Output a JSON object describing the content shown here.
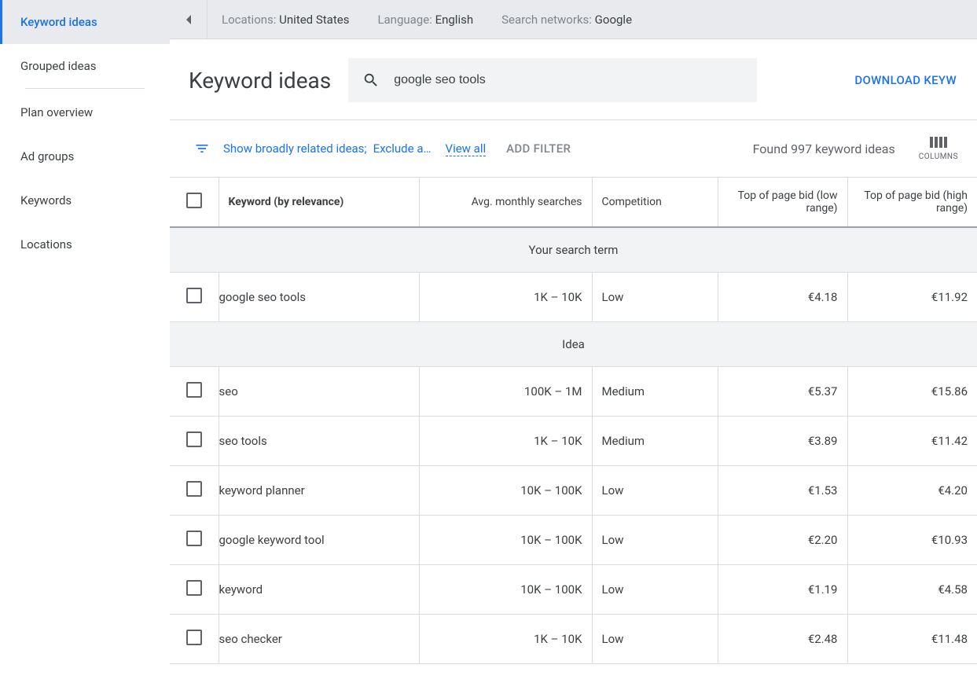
{
  "sidebar": {
    "items": [
      {
        "label": "Keyword ideas",
        "active": true
      },
      {
        "label": "Grouped ideas"
      },
      {
        "label": "Plan overview"
      },
      {
        "label": "Ad groups"
      },
      {
        "label": "Keywords"
      },
      {
        "label": "Locations"
      }
    ]
  },
  "topbar": {
    "locations_label": "Locations:",
    "locations_value": "United States",
    "language_label": "Language:",
    "language_value": "English",
    "networks_label": "Search networks:",
    "networks_value": "Google"
  },
  "header": {
    "title": "Keyword ideas",
    "search_value": "google seo tools",
    "download_label": "DOWNLOAD KEYW"
  },
  "filters": {
    "chip1": "Show broadly related ideas;",
    "chip2": "Exclude a…",
    "view_all": "View all",
    "add_filter": "ADD FILTER",
    "found_text": "Found 997 keyword ideas",
    "columns_label": "COLUMNS"
  },
  "table": {
    "headers": {
      "keyword": "Keyword (by relevance)",
      "searches": "Avg. monthly searches",
      "competition": "Competition",
      "bid_low": "Top of page bid (low range)",
      "bid_high": "Top of page bid (high range)"
    },
    "section1": "Your search term",
    "section2": "Idea",
    "search_term_rows": [
      {
        "keyword": "google seo tools",
        "searches": "1K – 10K",
        "competition": "Low",
        "bid_low": "€4.18",
        "bid_high": "€11.92"
      }
    ],
    "idea_rows": [
      {
        "keyword": "seo",
        "searches": "100K – 1M",
        "competition": "Medium",
        "bid_low": "€5.37",
        "bid_high": "€15.86"
      },
      {
        "keyword": "seo tools",
        "searches": "1K – 10K",
        "competition": "Medium",
        "bid_low": "€3.89",
        "bid_high": "€11.42"
      },
      {
        "keyword": "keyword planner",
        "searches": "10K – 100K",
        "competition": "Low",
        "bid_low": "€1.53",
        "bid_high": "€4.20"
      },
      {
        "keyword": "google keyword tool",
        "searches": "10K – 100K",
        "competition": "Low",
        "bid_low": "€2.20",
        "bid_high": "€10.93"
      },
      {
        "keyword": "keyword",
        "searches": "10K – 100K",
        "competition": "Low",
        "bid_low": "€1.19",
        "bid_high": "€4.58"
      },
      {
        "keyword": "seo checker",
        "searches": "1K – 10K",
        "competition": "Low",
        "bid_low": "€2.48",
        "bid_high": "€11.48"
      }
    ]
  }
}
